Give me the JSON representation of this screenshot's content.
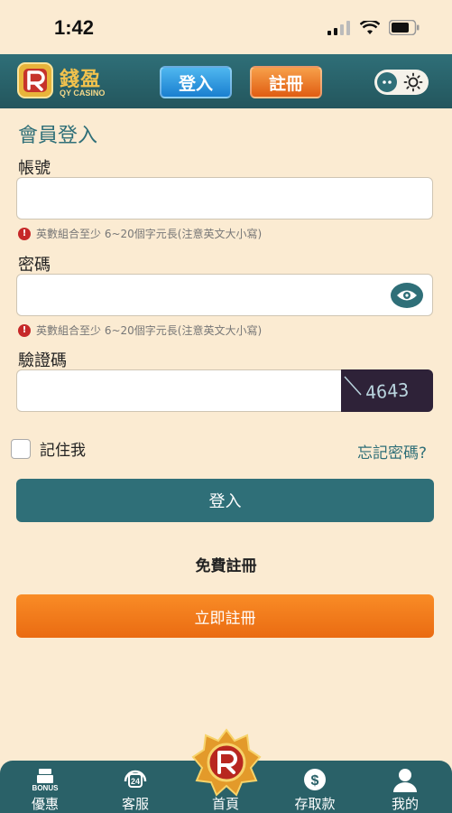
{
  "status_bar": {
    "time": "1:42"
  },
  "header": {
    "logo_title": "錢盈",
    "logo_subtitle": "QY CASINO",
    "login_label": "登入",
    "register_label": "註冊"
  },
  "form": {
    "title": "會員登入",
    "account_label": "帳號",
    "account_value": "",
    "account_hint": "英數組合至少 6~20個字元長(注意英文大小寫)",
    "password_label": "密碼",
    "password_value": "",
    "password_hint": "英數組合至少 6~20個字元長(注意英文大小寫)",
    "captcha_label": "驗證碼",
    "captcha_value": "",
    "captcha_code": "4643",
    "remember_label": "記住我",
    "forgot_label": "忘記密碼?",
    "login_button": "登入",
    "free_register_text": "免費註冊",
    "register_button": "立即註冊"
  },
  "bottom_nav": {
    "items": [
      {
        "label": "優惠",
        "icon": "gift-icon",
        "icon_text": "BONUS"
      },
      {
        "label": "客服",
        "icon": "headset-icon",
        "icon_text": "24"
      },
      {
        "label": "首頁",
        "icon": "home-badge-icon"
      },
      {
        "label": "存取款",
        "icon": "dollar-icon",
        "icon_text": "$"
      },
      {
        "label": "我的",
        "icon": "user-icon"
      }
    ]
  },
  "colors": {
    "background": "#fbebd2",
    "primary_teal": "#2f6f78",
    "accent_orange": "#ea6b12",
    "error_red": "#c62828"
  }
}
